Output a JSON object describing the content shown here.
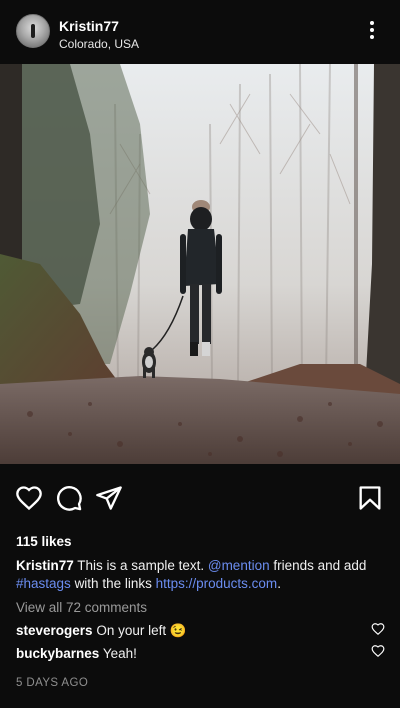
{
  "post": {
    "username": "Kristin77",
    "location": "Colorado, USA",
    "likes": "115 likes",
    "caption": {
      "username": "Kristin77",
      "text_1": "This is a sample text.",
      "mention": "@mention",
      "text_2": "friends and add",
      "hashtag": "#hastags",
      "text_3": "with the links",
      "url": "https://products.com",
      "text_4": "."
    },
    "view_all_comments": "View all 72 comments",
    "comments": [
      {
        "username": "steverogers",
        "text": "On your left",
        "emoji": "😉"
      },
      {
        "username": "buckybarnes",
        "text": "Yeah!"
      }
    ],
    "timestamp": "5 DAYS AGO"
  },
  "icons": {
    "more": "more-vertical-icon",
    "like": "heart-outline-icon",
    "comment": "comment-bubble-icon",
    "share": "paper-plane-icon",
    "save": "bookmark-outline-icon"
  },
  "colors": {
    "background": "#0c0c0c",
    "link": "#6b8df0",
    "muted": "#9a9a9a"
  }
}
